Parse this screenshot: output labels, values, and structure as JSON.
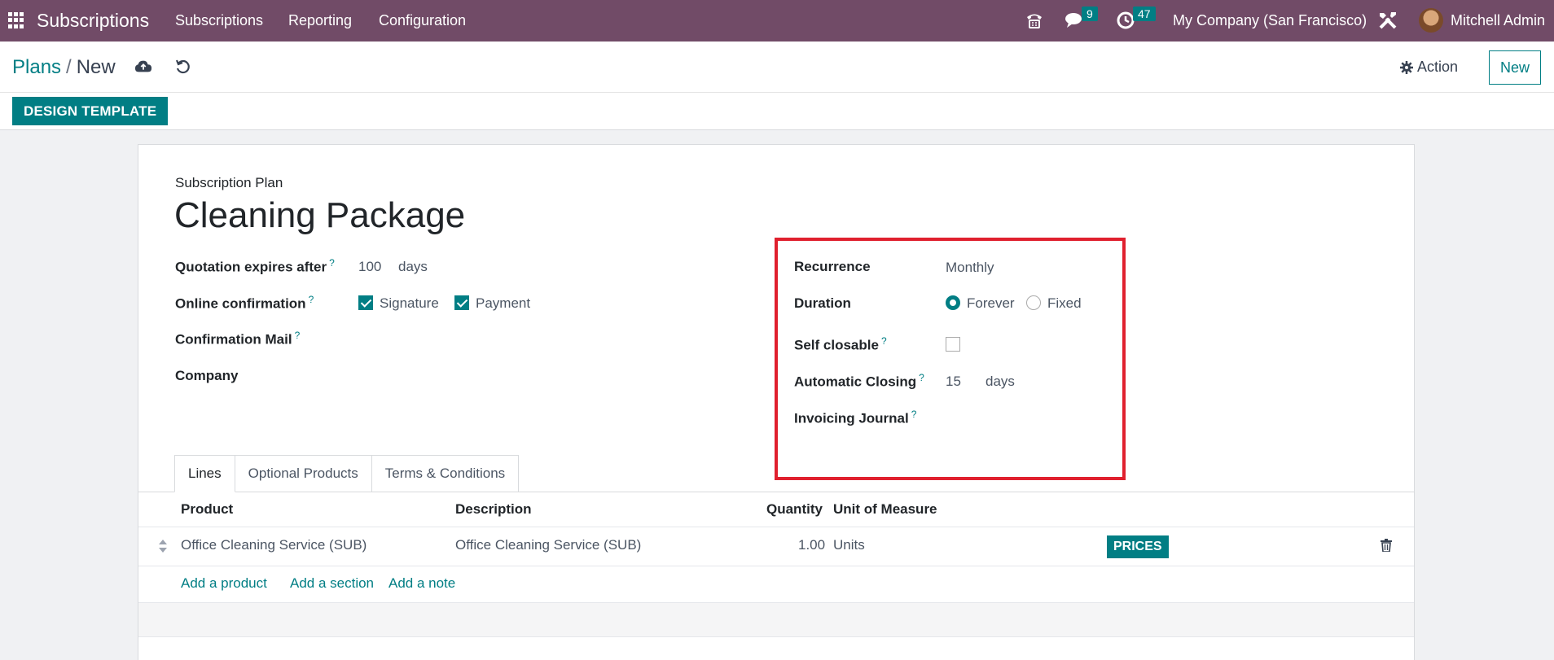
{
  "navbar": {
    "app_name": "Subscriptions",
    "menu": [
      "Subscriptions",
      "Reporting",
      "Configuration"
    ],
    "messages_count": "9",
    "activities_count": "47",
    "company": "My Company (San Francisco)",
    "user": "Mitchell Admin"
  },
  "breadcrumb": {
    "parent": "Plans",
    "separator": "/",
    "current": "New"
  },
  "controls": {
    "action_label": "Action",
    "new_label": "New"
  },
  "statusbar": {
    "design_template_label": "DESIGN TEMPLATE"
  },
  "form": {
    "plan_label": "Subscription Plan",
    "plan_name": "Cleaning Package",
    "quotation_expires_label": "Quotation expires after",
    "quotation_expires_value": "100",
    "quotation_expires_unit": "days",
    "online_confirmation_label": "Online confirmation",
    "signature_label": "Signature",
    "signature_checked": true,
    "payment_label": "Payment",
    "payment_checked": true,
    "confirmation_mail_label": "Confirmation Mail",
    "company_label": "Company",
    "recurrence_label": "Recurrence",
    "recurrence_value": "Monthly",
    "duration_label": "Duration",
    "duration_options": [
      "Forever",
      "Fixed"
    ],
    "duration_selected": "Forever",
    "self_closable_label": "Self closable",
    "self_closable_checked": false,
    "automatic_closing_label": "Automatic Closing",
    "automatic_closing_value": "15",
    "automatic_closing_unit": "days",
    "invoicing_journal_label": "Invoicing Journal",
    "help_mark": "?"
  },
  "tabs": [
    "Lines",
    "Optional Products",
    "Terms & Conditions"
  ],
  "lines_table": {
    "columns": [
      "Product",
      "Description",
      "Quantity",
      "Unit of Measure"
    ],
    "rows": [
      {
        "product": "Office Cleaning Service (SUB)",
        "description": "Office Cleaning Service (SUB)",
        "quantity": "1.00",
        "uom": "Units",
        "prices_label": "PRICES"
      }
    ],
    "add_links": [
      "Add a product",
      "Add a section",
      "Add a note"
    ]
  },
  "colors": {
    "navbar": "#714b67",
    "accent": "#017e84",
    "highlight": "#e0202e"
  }
}
